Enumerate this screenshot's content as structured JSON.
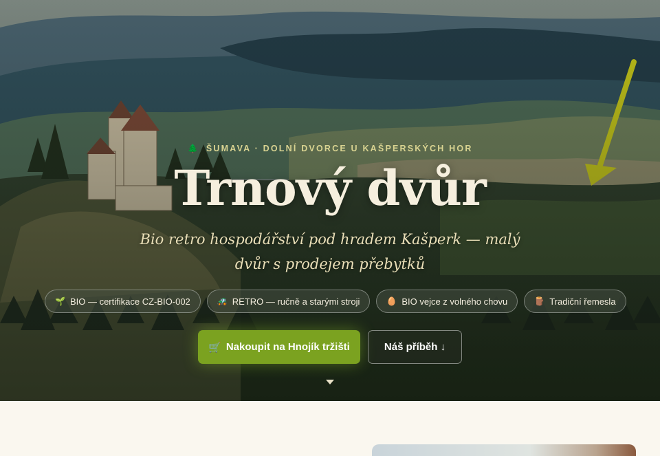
{
  "hero": {
    "eyebrow_icon": "🌲",
    "eyebrow": "ŠUMAVA · DOLNÍ DVORCE U KAŠPERSKÝCH HOR",
    "title": "Trnový dvůr",
    "subtitle": "Bio retro hospodářství pod hradem Kašperk — malý dvůr s prodejem přebytků",
    "background": "mountain-landscape-castle-photo",
    "annotation": "yellow-arrow"
  },
  "badges": [
    {
      "icon": "🌱",
      "icon_name": "sprout-icon",
      "label": "BIO — certifikace CZ-BIO-002"
    },
    {
      "icon": "🚜",
      "icon_name": "tractor-icon",
      "label": "RETRO — ručně a starými stroji"
    },
    {
      "icon": "🥚",
      "icon_name": "egg-icon",
      "label": "BIO vejce z volného chovu"
    },
    {
      "icon": "🪵",
      "icon_name": "craft-icon",
      "label": "Tradiční řemesla"
    }
  ],
  "actions": {
    "primary_icon": "🛒",
    "primary_label": "Nakoupit na Hnojík tržišti",
    "secondary_label": "Náš příběh ↓"
  },
  "colors": {
    "accent": "#7ba220",
    "eyebrow": "#d9d391",
    "title": "#f6efde",
    "page_bg": "#faf7ef"
  }
}
